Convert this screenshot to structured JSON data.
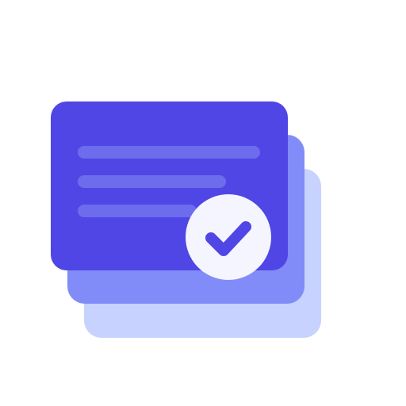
{
  "icon": {
    "name": "document-stack-verified-icon",
    "colors": {
      "card_front": "#4F46E5",
      "card_middle": "#818CF8",
      "card_back": "#C7D2FE",
      "text_lines": "#A5B4FC",
      "badge_fill": "#F5F5FF",
      "check_stroke": "#4F46E5",
      "background": "#FFFFFF"
    }
  }
}
